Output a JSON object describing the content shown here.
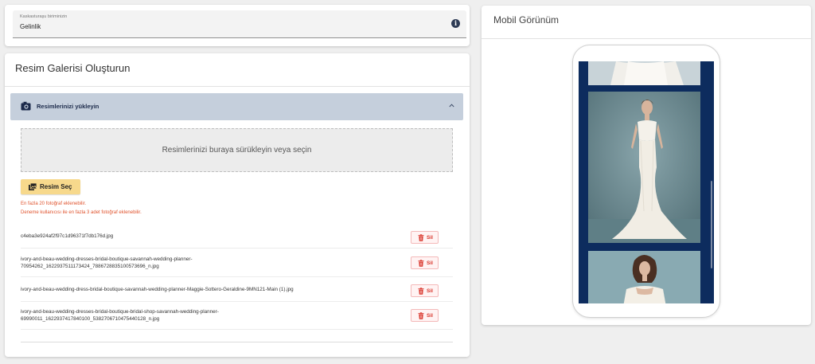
{
  "category": {
    "label": "Kaskasturaşu biriminizin",
    "value": "Gelinlik",
    "info_icon": "info-icon"
  },
  "gallery": {
    "title": "Resim Galerisi Oluşturun",
    "accordion_title": "Resimlerinizi yükleyin",
    "dropzone_text": "Resimlerinizi buraya sürükleyin veya seçin",
    "select_button": "Resim Seç",
    "warnings": [
      "En fazla 20 fotoğraf eklenebilir.",
      "Deneme kullanıcısı ile en fazla 3 adet fotoğraf eklenebilir."
    ],
    "delete_label": "Sil",
    "files": [
      {
        "lines": [
          "c4eba3e924af2f97c1d96371f7db176d.jpg"
        ]
      },
      {
        "lines": [
          "ivory-and-beau-wedding-dresses-bridal-boutique-savannah-wedding-planner-",
          "70954262_1622937511173424_7886728835100573696_n.jpg"
        ]
      },
      {
        "lines": [
          "ivory-and-beau-wedding-dress-bridal-boutique-savannah-wedding-planner-Maggie-Sottero-Geraldine-9MN121-Main (1).jpg"
        ]
      },
      {
        "lines": [
          "ivory-and-beau-wedding-dresses-bridal-boutique-bridal-shop-savannah-wedding-planner-",
          "69990011_1622937417840100_5382706710475440128_n.jpg"
        ]
      }
    ]
  },
  "mobile": {
    "title": "Mobil Görünüm"
  },
  "colors": {
    "accordion_bg": "#c5cfdc",
    "select_button_bg": "#f7d98c",
    "warning": "#e0532d",
    "delete": "#d9352b",
    "phone_screen": "#0d2c5e"
  }
}
